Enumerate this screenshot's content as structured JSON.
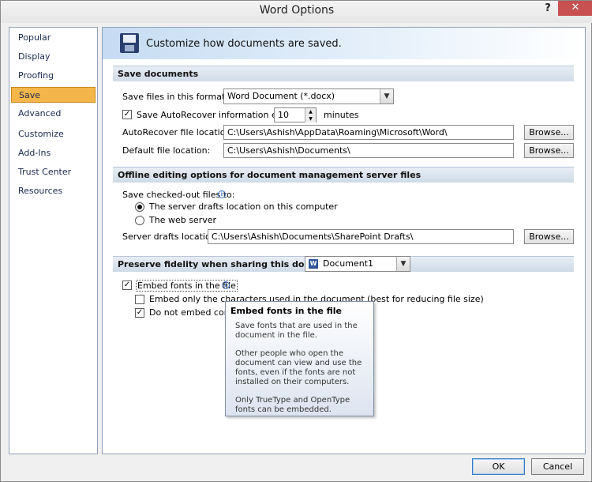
{
  "window": {
    "title": "Word Options",
    "help": "?",
    "close": "✕"
  },
  "sidebar": {
    "items": [
      {
        "label": "Popular"
      },
      {
        "label": "Display"
      },
      {
        "label": "Proofing"
      },
      {
        "label": "Save"
      },
      {
        "label": "Advanced"
      },
      {
        "label": "Customize"
      },
      {
        "label": "Add-Ins"
      },
      {
        "label": "Trust Center"
      },
      {
        "label": "Resources"
      }
    ],
    "selected": "Save"
  },
  "banner": {
    "text": "Customize how documents are saved."
  },
  "save_documents": {
    "header": "Save documents",
    "format_label": "Save files in this format:",
    "format_value": "Word Document (*.docx)",
    "autorecover_label": "Save AutoRecover information every",
    "autorecover_checked": true,
    "autorecover_minutes": "10",
    "minutes_label": "minutes",
    "autorecover_location_label": "AutoRecover file location:",
    "autorecover_location": "C:\\Users\\Ashish\\AppData\\Roaming\\Microsoft\\Word\\",
    "default_location_label": "Default file location:",
    "default_location": "C:\\Users\\Ashish\\Documents\\",
    "browse": "Browse..."
  },
  "offline": {
    "header": "Offline editing options for document management server files",
    "checked_out_label": "Save checked-out files to:",
    "radio_server": "The server drafts location on this computer",
    "radio_web": "The web server",
    "selected": "server",
    "server_drafts_label": "Server drafts location:",
    "server_drafts_location": "C:\\Users\\Ashish\\Documents\\SharePoint Drafts\\",
    "browse": "Browse..."
  },
  "fidelity": {
    "header": "Preserve fidelity when sharing this document:",
    "document_value": "Document1",
    "embed_fonts": "Embed fonts in the file",
    "embed_fonts_checked": true,
    "embed_only_chars": "Embed only the characters used in the document (best for reducing file size)",
    "embed_only_chars_checked": false,
    "do_not_embed": "Do not embed comm",
    "do_not_embed_checked": true
  },
  "tooltip": {
    "title": "Embed fonts in the file",
    "p1": "Save fonts that are used in the document in the file.",
    "p2": "Other people who open the document can view and use the fonts, even if the fonts are not installed on their computers.",
    "p3": "Only TrueType and OpenType fonts can be embedded."
  },
  "footer": {
    "ok": "OK",
    "cancel": "Cancel"
  },
  "colors": {
    "selected_item": "#f4b54a",
    "close_button": "#c75050",
    "section_header": "#cfdbe8"
  }
}
